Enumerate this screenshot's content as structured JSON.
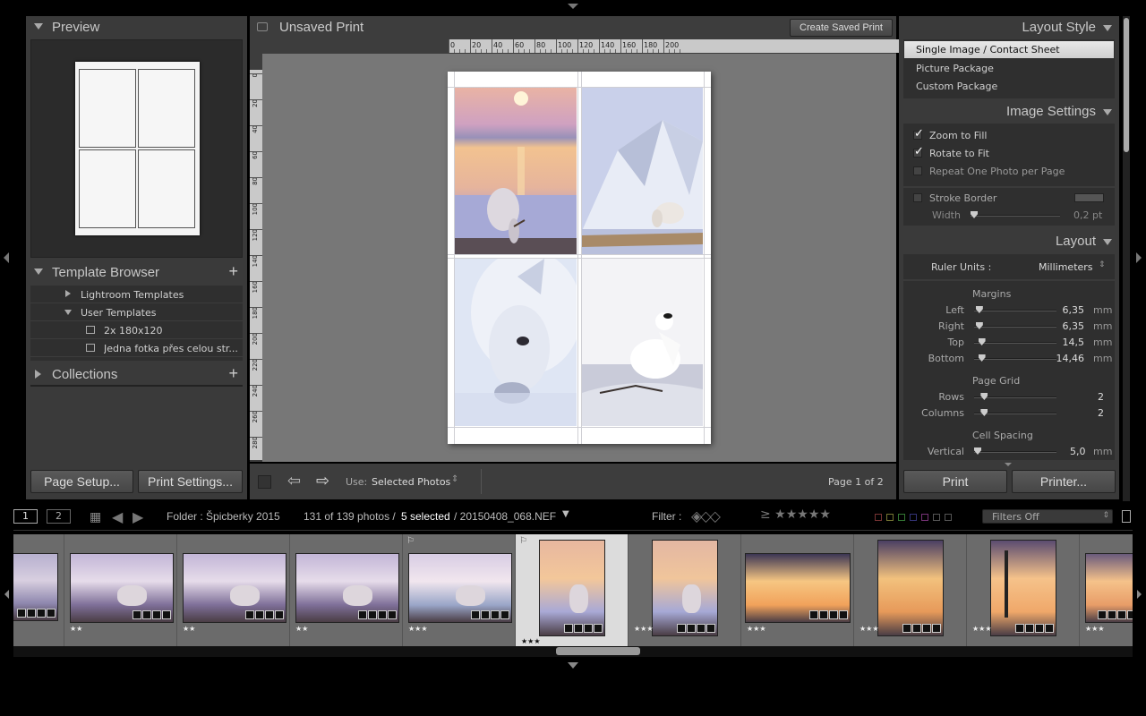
{
  "left_panel": {
    "preview_title": "Preview",
    "template_browser_title": "Template Browser",
    "template_items": [
      {
        "label": "Lightroom Templates"
      },
      {
        "label": "User Templates"
      },
      {
        "label": "2x 180x120"
      },
      {
        "label": "Jedna fotka přes celou str..."
      }
    ],
    "collections_title": "Collections",
    "page_setup_label": "Page Setup...",
    "print_settings_label": "Print Settings..."
  },
  "center": {
    "print_title": "Unsaved Print",
    "create_saved_print_label": "Create Saved Print",
    "ruler_top_ticks": [
      "0",
      "20",
      "40",
      "60",
      "80",
      "100",
      "120",
      "140",
      "160",
      "180",
      "200"
    ],
    "ruler_left_ticks": [
      "0",
      "20",
      "40",
      "60",
      "80",
      "100",
      "120",
      "140",
      "160",
      "180",
      "200",
      "220",
      "240",
      "260",
      "280"
    ],
    "use_label": "Use:",
    "use_value": "Selected Photos",
    "page_info": "Page 1 of 2"
  },
  "right_panel": {
    "layout_style_title": "Layout Style",
    "layout_styles": [
      "Single Image / Contact Sheet",
      "Picture Package",
      "Custom Package"
    ],
    "image_settings_title": "Image Settings",
    "zoom_to_fill": "Zoom to Fill",
    "rotate_to_fit": "Rotate to Fit",
    "repeat_one_photo": "Repeat One Photo per Page",
    "stroke_border": "Stroke Border",
    "width_label": "Width",
    "width_value": "0,2 pt",
    "layout_title": "Layout",
    "ruler_units_label": "Ruler Units :",
    "ruler_units_value": "Millimeters",
    "margins_title": "Margins",
    "margins": [
      {
        "label": "Left",
        "value": "6,35",
        "unit": "mm",
        "pos": 0.02
      },
      {
        "label": "Right",
        "value": "6,35",
        "unit": "mm",
        "pos": 0.02
      },
      {
        "label": "Top",
        "value": "14,5",
        "unit": "mm",
        "pos": 0.05
      },
      {
        "label": "Bottom",
        "value": "14,46",
        "unit": "mm",
        "pos": 0.05
      }
    ],
    "page_grid_title": "Page Grid",
    "page_grid": [
      {
        "label": "Rows",
        "value": "2",
        "pos": 0.08
      },
      {
        "label": "Columns",
        "value": "2",
        "pos": 0.08
      }
    ],
    "cell_spacing_title": "Cell Spacing",
    "vertical_label": "Vertical",
    "vertical_value": "5,0",
    "vertical_unit": "mm",
    "print_label": "Print",
    "printer_label": "Printer..."
  },
  "filmstrip_bar": {
    "page1": "1",
    "page2": "2",
    "folder_text": "Folder : Špicberky 2015",
    "count_text": "131 of 139 photos /",
    "selected_text": "5 selected",
    "file_text": "/ 20150408_068.NEF",
    "filter_label": "Filter :",
    "filters_off": "Filters Off"
  },
  "filmstrip": {
    "thumbs": [
      {
        "stars": "",
        "selected": false
      },
      {
        "stars": "★★",
        "selected": false
      },
      {
        "stars": "★★",
        "selected": false
      },
      {
        "stars": "★★",
        "selected": false
      },
      {
        "stars": "★★★",
        "selected": false
      },
      {
        "stars": "★★★",
        "selected": true
      },
      {
        "stars": "★★★",
        "selected": false
      },
      {
        "stars": "★★★",
        "selected": false
      },
      {
        "stars": "★★★",
        "selected": false
      },
      {
        "stars": "★★★",
        "selected": false
      },
      {
        "stars": "★★★",
        "selected": false
      }
    ]
  }
}
